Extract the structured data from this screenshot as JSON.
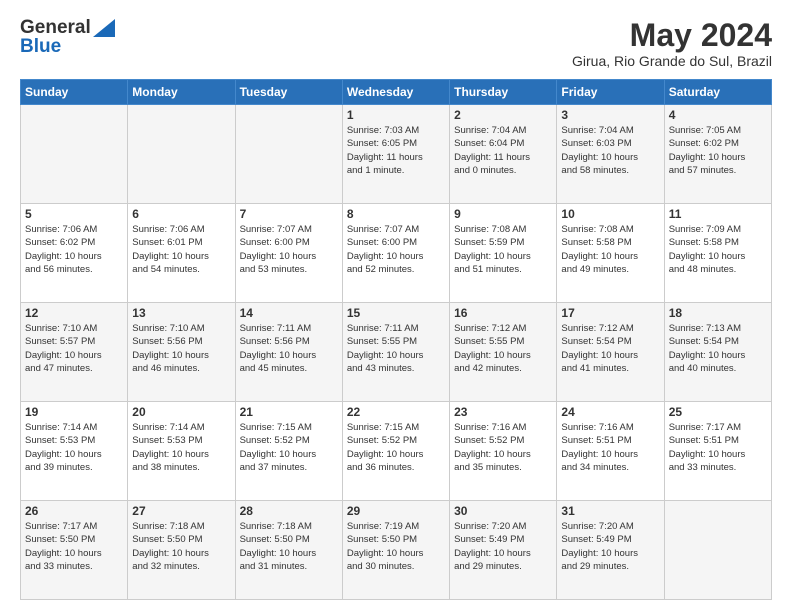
{
  "header": {
    "logo_general": "General",
    "logo_blue": "Blue",
    "month_year": "May 2024",
    "location": "Girua, Rio Grande do Sul, Brazil"
  },
  "days_of_week": [
    "Sunday",
    "Monday",
    "Tuesday",
    "Wednesday",
    "Thursday",
    "Friday",
    "Saturday"
  ],
  "weeks": [
    [
      {
        "day": "",
        "info": ""
      },
      {
        "day": "",
        "info": ""
      },
      {
        "day": "",
        "info": ""
      },
      {
        "day": "1",
        "info": "Sunrise: 7:03 AM\nSunset: 6:05 PM\nDaylight: 11 hours\nand 1 minute."
      },
      {
        "day": "2",
        "info": "Sunrise: 7:04 AM\nSunset: 6:04 PM\nDaylight: 11 hours\nand 0 minutes."
      },
      {
        "day": "3",
        "info": "Sunrise: 7:04 AM\nSunset: 6:03 PM\nDaylight: 10 hours\nand 58 minutes."
      },
      {
        "day": "4",
        "info": "Sunrise: 7:05 AM\nSunset: 6:02 PM\nDaylight: 10 hours\nand 57 minutes."
      }
    ],
    [
      {
        "day": "5",
        "info": "Sunrise: 7:06 AM\nSunset: 6:02 PM\nDaylight: 10 hours\nand 56 minutes."
      },
      {
        "day": "6",
        "info": "Sunrise: 7:06 AM\nSunset: 6:01 PM\nDaylight: 10 hours\nand 54 minutes."
      },
      {
        "day": "7",
        "info": "Sunrise: 7:07 AM\nSunset: 6:00 PM\nDaylight: 10 hours\nand 53 minutes."
      },
      {
        "day": "8",
        "info": "Sunrise: 7:07 AM\nSunset: 6:00 PM\nDaylight: 10 hours\nand 52 minutes."
      },
      {
        "day": "9",
        "info": "Sunrise: 7:08 AM\nSunset: 5:59 PM\nDaylight: 10 hours\nand 51 minutes."
      },
      {
        "day": "10",
        "info": "Sunrise: 7:08 AM\nSunset: 5:58 PM\nDaylight: 10 hours\nand 49 minutes."
      },
      {
        "day": "11",
        "info": "Sunrise: 7:09 AM\nSunset: 5:58 PM\nDaylight: 10 hours\nand 48 minutes."
      }
    ],
    [
      {
        "day": "12",
        "info": "Sunrise: 7:10 AM\nSunset: 5:57 PM\nDaylight: 10 hours\nand 47 minutes."
      },
      {
        "day": "13",
        "info": "Sunrise: 7:10 AM\nSunset: 5:56 PM\nDaylight: 10 hours\nand 46 minutes."
      },
      {
        "day": "14",
        "info": "Sunrise: 7:11 AM\nSunset: 5:56 PM\nDaylight: 10 hours\nand 45 minutes."
      },
      {
        "day": "15",
        "info": "Sunrise: 7:11 AM\nSunset: 5:55 PM\nDaylight: 10 hours\nand 43 minutes."
      },
      {
        "day": "16",
        "info": "Sunrise: 7:12 AM\nSunset: 5:55 PM\nDaylight: 10 hours\nand 42 minutes."
      },
      {
        "day": "17",
        "info": "Sunrise: 7:12 AM\nSunset: 5:54 PM\nDaylight: 10 hours\nand 41 minutes."
      },
      {
        "day": "18",
        "info": "Sunrise: 7:13 AM\nSunset: 5:54 PM\nDaylight: 10 hours\nand 40 minutes."
      }
    ],
    [
      {
        "day": "19",
        "info": "Sunrise: 7:14 AM\nSunset: 5:53 PM\nDaylight: 10 hours\nand 39 minutes."
      },
      {
        "day": "20",
        "info": "Sunrise: 7:14 AM\nSunset: 5:53 PM\nDaylight: 10 hours\nand 38 minutes."
      },
      {
        "day": "21",
        "info": "Sunrise: 7:15 AM\nSunset: 5:52 PM\nDaylight: 10 hours\nand 37 minutes."
      },
      {
        "day": "22",
        "info": "Sunrise: 7:15 AM\nSunset: 5:52 PM\nDaylight: 10 hours\nand 36 minutes."
      },
      {
        "day": "23",
        "info": "Sunrise: 7:16 AM\nSunset: 5:52 PM\nDaylight: 10 hours\nand 35 minutes."
      },
      {
        "day": "24",
        "info": "Sunrise: 7:16 AM\nSunset: 5:51 PM\nDaylight: 10 hours\nand 34 minutes."
      },
      {
        "day": "25",
        "info": "Sunrise: 7:17 AM\nSunset: 5:51 PM\nDaylight: 10 hours\nand 33 minutes."
      }
    ],
    [
      {
        "day": "26",
        "info": "Sunrise: 7:17 AM\nSunset: 5:50 PM\nDaylight: 10 hours\nand 33 minutes."
      },
      {
        "day": "27",
        "info": "Sunrise: 7:18 AM\nSunset: 5:50 PM\nDaylight: 10 hours\nand 32 minutes."
      },
      {
        "day": "28",
        "info": "Sunrise: 7:18 AM\nSunset: 5:50 PM\nDaylight: 10 hours\nand 31 minutes."
      },
      {
        "day": "29",
        "info": "Sunrise: 7:19 AM\nSunset: 5:50 PM\nDaylight: 10 hours\nand 30 minutes."
      },
      {
        "day": "30",
        "info": "Sunrise: 7:20 AM\nSunset: 5:49 PM\nDaylight: 10 hours\nand 29 minutes."
      },
      {
        "day": "31",
        "info": "Sunrise: 7:20 AM\nSunset: 5:49 PM\nDaylight: 10 hours\nand 29 minutes."
      },
      {
        "day": "",
        "info": ""
      }
    ]
  ]
}
